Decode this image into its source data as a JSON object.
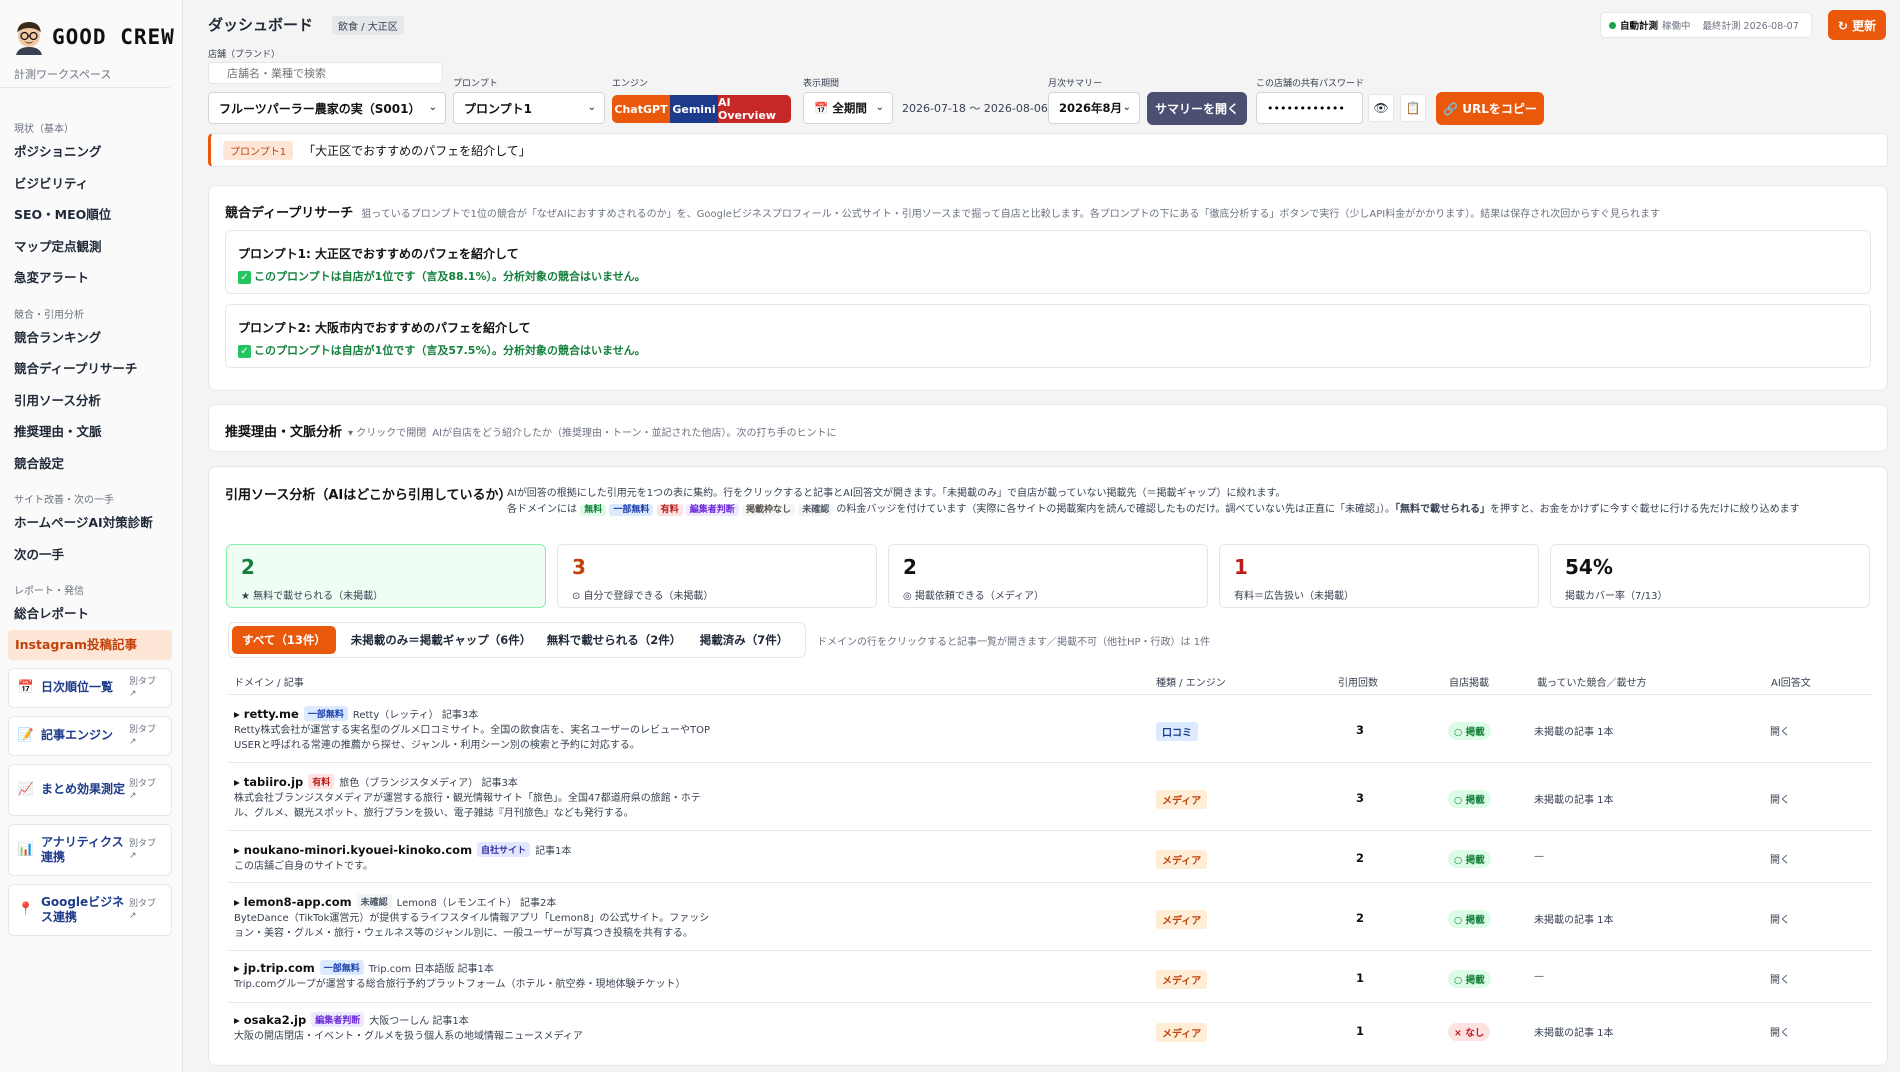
{
  "sidebar": {
    "logo": "GOOD CREW",
    "workspace": "計測ワークスペース",
    "sections": [
      {
        "title": "現状（基本）",
        "items": [
          "ポジショニング",
          "ビジビリティ",
          "SEO・MEO順位",
          "マップ定点観測",
          "急変アラート"
        ]
      },
      {
        "title": "競合・引用分析",
        "items": [
          "競合ランキング",
          "競合ディープリサーチ",
          "引用ソース分析",
          "推奨理由・文脈",
          "競合設定"
        ]
      },
      {
        "title": "サイト改善・次の一手",
        "items": [
          "ホームページAI対策診断",
          "次の一手"
        ]
      },
      {
        "title": "レポート・発信",
        "items": [
          "総合レポート",
          "Instagram投稿記事"
        ]
      }
    ],
    "external": [
      {
        "icon": "calendar-icon",
        "label": "日次順位一覧",
        "tag": "別タブ ↗"
      },
      {
        "icon": "memo-icon",
        "label": "記事エンジン",
        "tag": "別タブ ↗"
      },
      {
        "icon": "chart-up-icon",
        "label": "まとめ効果測定",
        "tag": "別タブ ↗"
      },
      {
        "icon": "bar-chart-icon",
        "label": "アナリティクス連携",
        "tag": "別タブ ↗"
      },
      {
        "icon": "pin-icon",
        "label": "Googleビジネス連携",
        "tag": "別タブ ↗"
      }
    ]
  },
  "header": {
    "title": "ダッシュボード",
    "badge": "飲食 / 大正区",
    "auto_label": "自動計測",
    "auto_state": "稼働中",
    "last_measured": "最終計測 2026-08-07",
    "refresh": "↻ 更新"
  },
  "controls": {
    "store_label": "店舗（ブランド）",
    "search_placeholder": "店舗名・業種で検索",
    "store_value": "フルーツパーラー農家の実（S001）",
    "prompt_label": "プロンプト",
    "prompt_value": "プロンプト1",
    "engine_label": "エンジン",
    "engines": [
      "ChatGPT",
      "Gemini",
      "AI Overview"
    ],
    "period_label": "表示期間",
    "period_value": "全期間",
    "date_range": "2026-07-18 〜 2026-08-06",
    "summary_label": "月次サマリー",
    "summary_value": "2026年8月",
    "summary_btn": "サマリーを開く",
    "pw_label": "この店舗の共有パスワード",
    "pw_value": "••••••••••••",
    "copy_btn": "URLをコピー",
    "eye_icon": "👁",
    "clip_icon": "📋"
  },
  "prompt_bar": {
    "tag": "プロンプト1",
    "text": "「大正区でおすすめのパフェを紹介して」"
  },
  "deep_research": {
    "title": "競合ディープリサーチ",
    "desc": "狙っているプロンプトで1位の競合が「なぜAIにおすすめされるのか」を、Googleビジネスプロフィール・公式サイト・引用ソースまで掘って自店と比較します。各プロンプトの下にある「徹底分析する」ボタンで実行（少しAPI料金がかかります）。結果は保存され次回からすぐ見られます",
    "items": [
      {
        "title": "プロンプト1: 大正区でおすすめのパフェを紹介して",
        "result": "このプロンプトは自店が1位です（言及88.1%）。分析対象の競合はいません。"
      },
      {
        "title": "プロンプト2: 大阪市内でおすすめのパフェを紹介して",
        "result": "このプロンプトは自店が1位です（言及57.5%）。分析対象の競合はいません。"
      }
    ]
  },
  "reasons": {
    "title": "推奨理由・文脈分析",
    "toggle": "▾ クリックで開閉",
    "desc": "AIが自店をどう紹介したか（推奨理由・トーン・並記された他店）。次の打ち手のヒントに"
  },
  "citation": {
    "title": "引用ソース分析（AIはどこから引用しているか）",
    "desc1": "AIが回答の根拠にした引用元を1つの表に集約。行をクリックすると記事とAI回答文が開きます。「未掲載のみ」で自店が載っていない掲載先（＝掲載ギャップ）に絞れます。",
    "desc2_pre": "各ドメインには",
    "legend": [
      "無料",
      "一部無料",
      "有料",
      "編集者判断",
      "掲載枠なし",
      "未確認"
    ],
    "desc2_post": "の料金バッジを付けています（実際に各サイトの掲載案内を読んで確認したものだけ。調べていない先は正直に「未確認」）。",
    "desc2_bold": "「無料で載せられる」",
    "desc2_end": "を押すと、お金をかけずに今すぐ載せに行ける先だけに絞り込めます",
    "stats": [
      {
        "num": "2",
        "label": "★ 無料で載せられる（未掲載）",
        "color": "#15803d"
      },
      {
        "num": "3",
        "label": "⊙ 自分で登録できる（未掲載）",
        "color": "#c2410c"
      },
      {
        "num": "2",
        "label": "◎ 掲載依頼できる（メディア）",
        "color": "#111111"
      },
      {
        "num": "1",
        "label": "有料＝広告扱い（未掲載）",
        "color": "#b91c1c"
      },
      {
        "num": "54%",
        "label": "掲載カバー率（7/13）",
        "color": "#111111"
      }
    ],
    "tabs": [
      "すべて（13件）",
      "未掲載のみ＝掲載ギャップ（6件）",
      "無料で載せられる（2件）",
      "掲載済み（7件）"
    ],
    "tab_note": "ドメインの行をクリックすると記事一覧が開きます／掲載不可（他社HP・行政）は 1件",
    "columns": [
      "ドメイン / 記事",
      "種類 / エンジン",
      "引用回数",
      "自店掲載",
      "載っていた競合／載せ方",
      "AI回答文"
    ],
    "rows": [
      {
        "domain": "▸ retty.me",
        "badge": "一部無料",
        "badge_class": "b-partial",
        "extra": "Retty（レッティ） 記事3本",
        "desc": "Retty株式会社が運営する実名型のグルメ口コミサイト。全国の飲食店を、実名ユーザーのレビューやTOP USERと呼ばれる常連の推薦から探せ、ジャンル・利用シーン別の検索と予約に対応する。",
        "kind": "口コミ",
        "kind_class": "k-review",
        "count": "3",
        "own": "○ 掲載",
        "own_class": "yes",
        "comp": "未掲載の記事 1本",
        "open": "開く"
      },
      {
        "domain": "▸ tabiiro.jp",
        "badge": "有料",
        "badge_class": "b-paid",
        "extra": "旅色（ブランジスタメディア） 記事3本",
        "desc": "株式会社ブランジスタメディアが運営する旅行・観光情報サイト「旅色」。全国47都道府県の旅館・ホテル、グルメ、観光スポット、旅行プランを扱い、電子雑誌『月刊旅色』なども発行する。",
        "kind": "メディア",
        "kind_class": "k-media",
        "count": "3",
        "own": "○ 掲載",
        "own_class": "yes",
        "comp": "未掲載の記事 1本",
        "open": "開く"
      },
      {
        "domain": "▸ noukano-minori.kyouei-kinoko.com",
        "badge": "自社サイト",
        "badge_class": "b-own",
        "extra": "記事1本",
        "desc": "この店舗ご自身のサイトです。",
        "kind": "メディア",
        "kind_class": "k-media",
        "count": "2",
        "own": "○ 掲載",
        "own_class": "yes",
        "comp": "—",
        "open": "開く"
      },
      {
        "domain": "▸ lemon8-app.com",
        "badge": "未確認",
        "badge_class": "b-unconfirmed",
        "extra": "Lemon8（レモンエイト） 記事2本",
        "desc": "ByteDance（TikTok運営元）が提供するライフスタイル情報アプリ「Lemon8」の公式サイト。ファッション・美容・グルメ・旅行・ウェルネス等のジャンル別に、一般ユーザーが写真つき投稿を共有する。",
        "kind": "メディア",
        "kind_class": "k-media",
        "count": "2",
        "own": "○ 掲載",
        "own_class": "yes",
        "comp": "未掲載の記事 1本",
        "open": "開く"
      },
      {
        "domain": "▸ jp.trip.com",
        "badge": "一部無料",
        "badge_class": "b-partial",
        "extra": "Trip.com 日本語版 記事1本",
        "desc": "Trip.comグループが運営する総合旅行予約プラットフォーム（ホテル・航空券・現地体験チケット）",
        "kind": "メディア",
        "kind_class": "k-media",
        "count": "1",
        "own": "○ 掲載",
        "own_class": "yes",
        "comp": "—",
        "open": "開く"
      },
      {
        "domain": "▸ osaka2.jp",
        "badge": "編集者判断",
        "badge_class": "b-editor",
        "extra": "大阪つーしん 記事1本",
        "desc": "大阪の開店閉店・イベント・グルメを扱う個人系の地域情報ニュースメディア",
        "kind": "メディア",
        "kind_class": "k-media",
        "count": "1",
        "own": "× なし",
        "own_class": "no",
        "comp": "未掲載の記事 1本",
        "open": "開く"
      }
    ]
  },
  "colors": {
    "accent": "#ea580c",
    "chatgpt": "#ea580c",
    "gemini": "#1e3a8a",
    "aioverview": "#c62828",
    "summary": "#4b4f72"
  }
}
